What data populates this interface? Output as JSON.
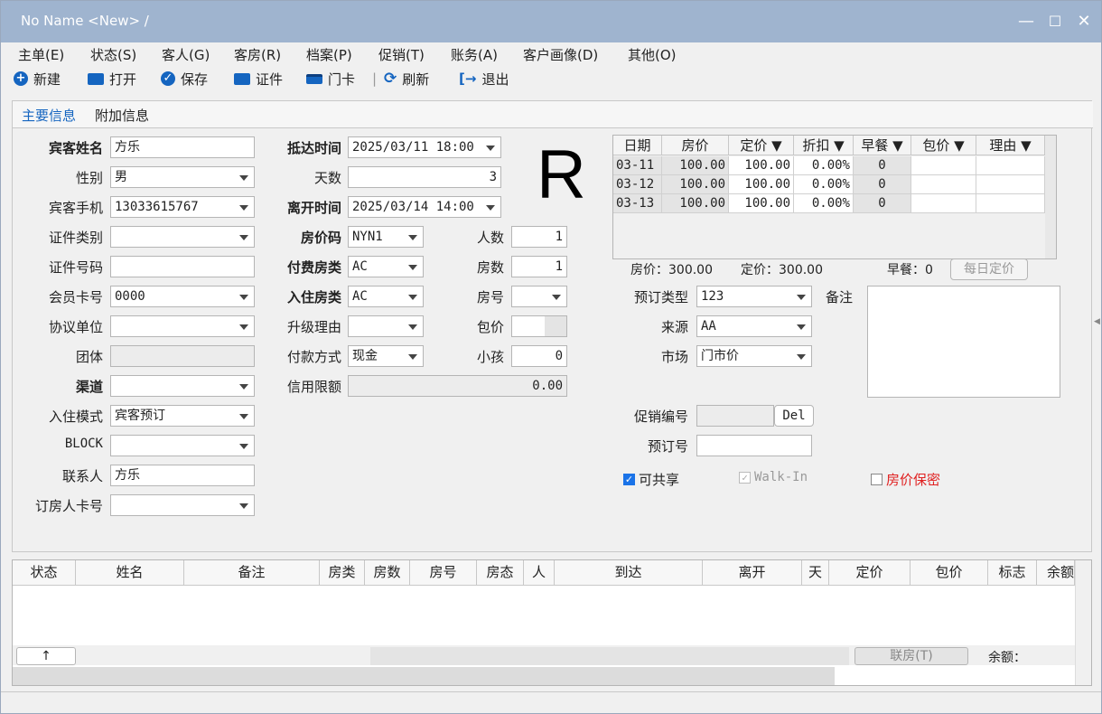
{
  "window": {
    "title": "No Name <New> /"
  },
  "menu": [
    "主单(E)",
    "状态(S)",
    "客人(G)",
    "客房(R)",
    "档案(P)",
    "促销(T)",
    "账务(A)",
    "客户画像(D)",
    "其他(O)"
  ],
  "toolbar": {
    "new": "新建",
    "open": "打开",
    "save": "保存",
    "id": "证件",
    "card": "门卡",
    "refresh": "刷新",
    "exit": "退出"
  },
  "tabs": {
    "main": "主要信息",
    "extra": "附加信息"
  },
  "labels": {
    "guest_name": "宾客姓名",
    "gender": "性别",
    "phone": "宾客手机",
    "id_type": "证件类别",
    "id_no": "证件号码",
    "member_card": "会员卡号",
    "company": "协议单位",
    "group": "团体",
    "channel": "渠道",
    "checkin_mode": "入住模式",
    "block": "BLOCK",
    "contact": "联系人",
    "booker_card": "订房人卡号",
    "arrival": "抵达时间",
    "days": "天数",
    "departure": "离开时间",
    "rate_code": "房价码",
    "paid_type": "付费房类",
    "room_type": "入住房类",
    "upgrade_reason": "升级理由",
    "pay_method": "付款方式",
    "credit_limit": "信用限额",
    "persons": "人数",
    "rooms": "房数",
    "room_no": "房号",
    "package": "包价",
    "child": "小孩",
    "booking_type": "预订类型",
    "source": "来源",
    "market": "市场",
    "remark": "备注",
    "promo_no": "促销编号",
    "booking_no": "预订号"
  },
  "values": {
    "guest_name": "方乐",
    "gender": "男",
    "phone": "13033615767",
    "id_type": "",
    "id_no": "",
    "member_card": "0000",
    "company": "",
    "group": "",
    "channel": "",
    "checkin_mode": "宾客预订",
    "block": "",
    "contact": "方乐",
    "booker_card": "",
    "arrival": "2025/03/11 18:00",
    "days": "3",
    "departure": "2025/03/14 14:00",
    "rate_code": "NYN1",
    "paid_type": "AC",
    "room_type": "AC",
    "upgrade_reason": "",
    "pay_method": "现金",
    "credit_limit": "0.00",
    "persons": "1",
    "rooms": "1",
    "room_no": "",
    "package": "",
    "child": "0",
    "booking_type": "123",
    "source": "AA",
    "market": "门市价",
    "promo_no": "",
    "booking_no": ""
  },
  "big_letter": "R",
  "rate_grid": {
    "headers": [
      "日期",
      "房价",
      "定价 ▼",
      "折扣 ▼",
      "早餐 ▼",
      "包价 ▼",
      "理由 ▼"
    ],
    "rows": [
      [
        "03-11",
        "100.00",
        "100.00",
        "0.00%",
        "0",
        "",
        ""
      ],
      [
        "03-12",
        "100.00",
        "100.00",
        "0.00%",
        "0",
        "",
        ""
      ],
      [
        "03-13",
        "100.00",
        "100.00",
        "0.00%",
        "0",
        "",
        ""
      ]
    ]
  },
  "rate_summary": {
    "room_price": "房价：300.00",
    "fixed_price": "定价：300.00",
    "breakfast": "早餐：0",
    "daily_button": "每日定价"
  },
  "del_button": "Del",
  "checks": {
    "shareable": "可共享",
    "walkin": "Walk-In",
    "rate_secret": "房价保密"
  },
  "bottom": {
    "headers": [
      "状态",
      "姓名",
      "备注",
      "房类",
      "房数",
      "房号",
      "房态",
      "人",
      "到达",
      "离开",
      "天",
      "定价",
      "包价",
      "标志",
      "余额"
    ],
    "up_button": "↑",
    "link_button": "联房(T)",
    "balance_label": "余额："
  },
  "colors": {
    "titlebar": "#9fb4cf",
    "accent": "#1565c0",
    "red": "#e02020"
  }
}
